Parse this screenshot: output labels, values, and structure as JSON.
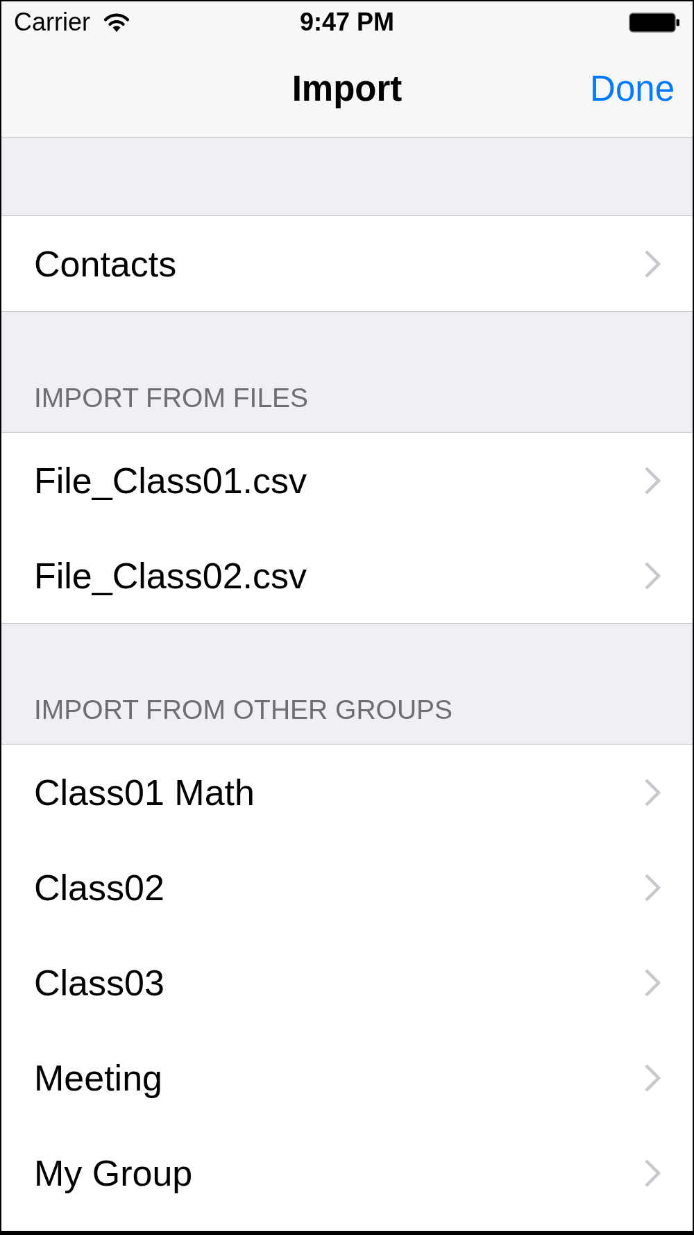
{
  "status_bar": {
    "carrier": "Carrier",
    "time": "9:47 PM"
  },
  "nav_bar": {
    "title": "Import",
    "done_button": "Done"
  },
  "sections": [
    {
      "rows": [
        {
          "label": "Contacts"
        }
      ]
    },
    {
      "header": "IMPORT FROM FILES",
      "rows": [
        {
          "label": "File_Class01.csv"
        },
        {
          "label": "File_Class02.csv"
        }
      ]
    },
    {
      "header": "IMPORT FROM OTHER GROUPS",
      "rows": [
        {
          "label": "Class01 Math"
        },
        {
          "label": "Class02"
        },
        {
          "label": "Class03"
        },
        {
          "label": "Meeting"
        },
        {
          "label": "My Group"
        }
      ]
    }
  ]
}
